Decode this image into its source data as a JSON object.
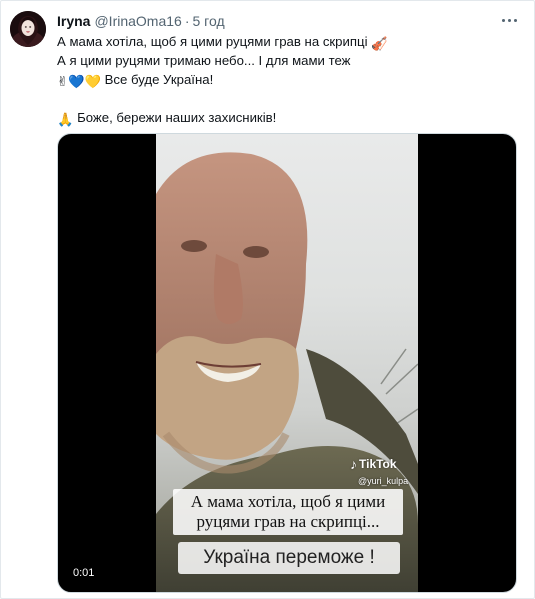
{
  "tweet": {
    "display_name": "Iryna",
    "handle": "@IrinaOma16",
    "separator": "·",
    "time": "5 год",
    "lines": [
      {
        "text": "А мама хотіла, щоб я цими руцями грав на скрипці",
        "emoji_after": "🎻"
      },
      {
        "text": "А я цими руцями тримаю небо... І для мами теж"
      },
      {
        "emoji_before": "✌💙💛",
        "text": "Все буде Україна!"
      },
      {
        "emoji_before": "🙏",
        "text": "Боже, бережи наших захисників!"
      }
    ]
  },
  "video": {
    "tiktok_label": "TikTok",
    "tiktok_user": "@yuri_kulpa",
    "caption_line1": "А мама хотіла, щоб я цими",
    "caption_line2": "руцями грав на скрипці...",
    "caption_bottom": "Україна переможе !",
    "timecode": "0:01"
  },
  "icons": {
    "more": "more-horizontal-icon",
    "tiktok": "tiktok-note-icon"
  },
  "colors": {
    "text": "#0f1419",
    "secondary": "#536471",
    "border": "#cfd9de"
  }
}
